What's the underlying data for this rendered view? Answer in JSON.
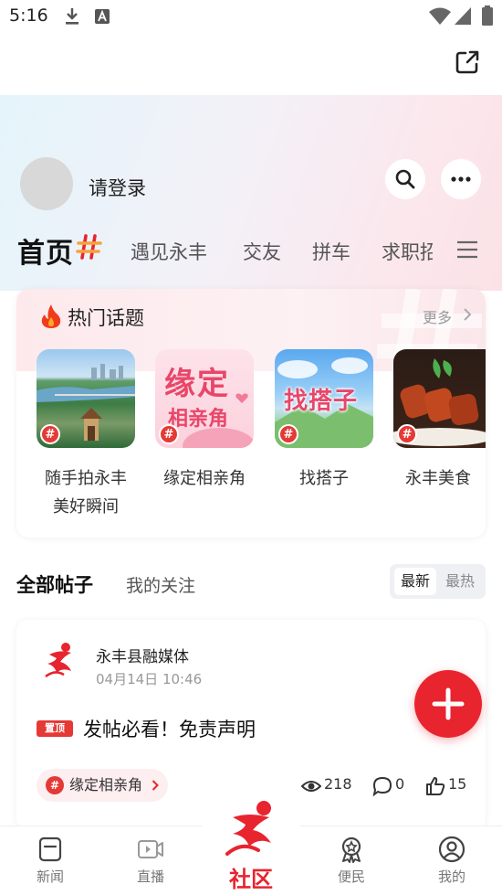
{
  "status_bar": {
    "time": "5:16"
  },
  "hero": {
    "login_text": "请登录"
  },
  "tabs": {
    "home": "首页",
    "items": [
      "遇见永丰",
      "交友",
      "拼车",
      "求职招聘"
    ]
  },
  "hot_topics": {
    "title": "热门话题",
    "more": "更多",
    "items": [
      {
        "label": "随手拍永丰\n美好瞬间"
      },
      {
        "label": "缘定相亲角",
        "thumb_text_1": "缘定",
        "thumb_text_2": "相亲角"
      },
      {
        "label": "找搭子",
        "thumb_text": "找搭子"
      },
      {
        "label": "永丰美食"
      }
    ]
  },
  "posts": {
    "tab_all": "全部帖子",
    "tab_follow": "我的关注",
    "sort_latest": "最新",
    "sort_hot": "最热"
  },
  "post": {
    "author": "永丰县融媒体",
    "time": "04月14日 10:46",
    "pin_badge": "置顶",
    "title": "发帖必看！免责声明",
    "tag": "缘定相亲角",
    "views": "218",
    "comments": "0",
    "likes": "15"
  },
  "bottom_nav": {
    "news": "新闻",
    "live": "直播",
    "community": "社区",
    "service": "便民",
    "mine": "我的"
  },
  "colors": {
    "accent": "#e8242f",
    "tag_bg": "#fdeef0"
  }
}
